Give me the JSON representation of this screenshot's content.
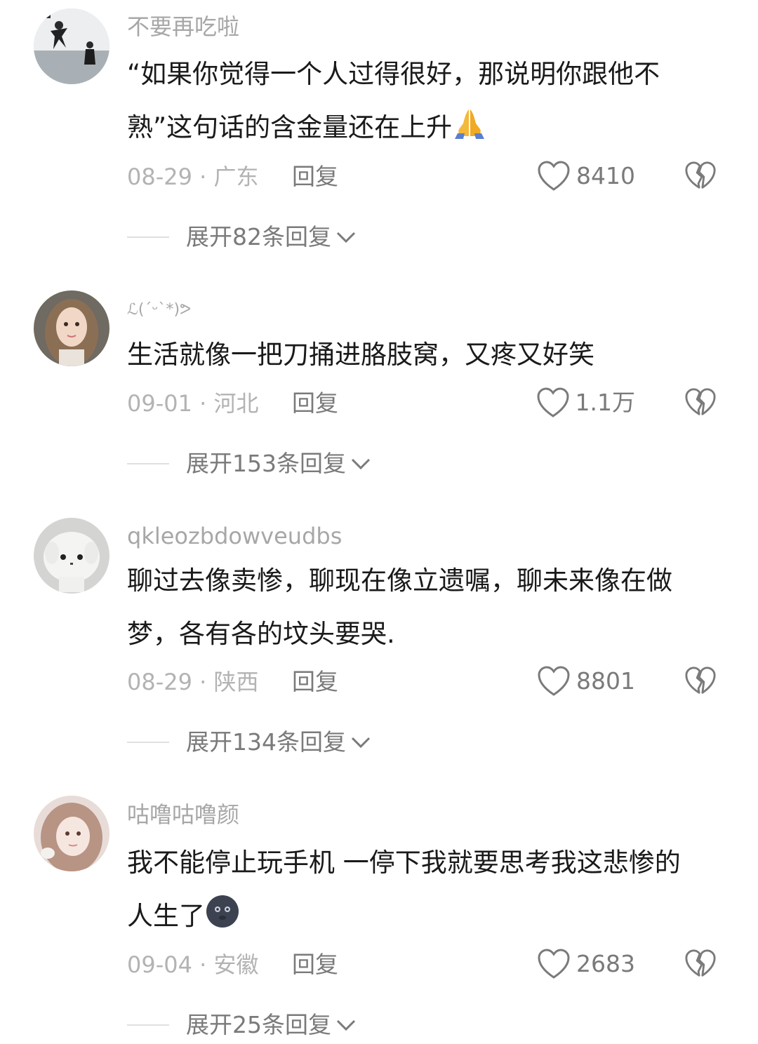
{
  "comments": [
    {
      "username": "不要再吃啦",
      "text_lines": [
        "“如果你觉得一个人过得很好，那说明你跟他不",
        "熟”这句话的含金量还在上升"
      ],
      "emoji": "folded-hands",
      "meta": "08-29 · 广东",
      "reply_label": "回复",
      "likes": "8410",
      "expand_label": "展开82条回复"
    },
    {
      "username": "ℒ(ˊᵕˋ*)ᕗ",
      "text_lines": [
        "生活就像一把刀捅进胳肢窝，又疼又好笑"
      ],
      "emoji": "",
      "meta": "09-01 · 河北",
      "reply_label": "回复",
      "likes": "1.1万",
      "expand_label": "展开153条回复"
    },
    {
      "username": "qkleozbdowveudbs",
      "text_lines": [
        "聊过去像卖惨，聊现在像立遗嘱，聊未来像在做",
        "梦，各有各的坟头要哭."
      ],
      "emoji": "",
      "meta": "08-29 · 陕西",
      "reply_label": "回复",
      "likes": "8801",
      "expand_label": "展开134条回复"
    },
    {
      "username": "咕噜咕噜颜",
      "text_lines": [
        "我不能停止玩手机 一停下我就要思考我这悲惨的",
        "人生了"
      ],
      "emoji": "new-moon-face",
      "meta": "09-04 · 安徽",
      "reply_label": "回复",
      "likes": "2683",
      "expand_label": "展开25条回复"
    }
  ],
  "colors": {
    "username": "#a7a7a7",
    "text": "#1a1a1a",
    "meta": "#b3b3b3",
    "action": "#7a7a7a"
  }
}
